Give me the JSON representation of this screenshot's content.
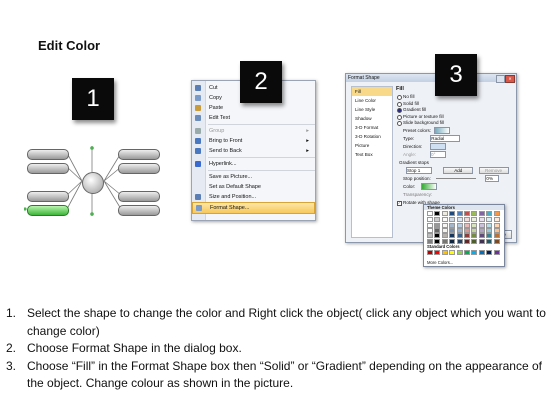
{
  "title": "Edit Color",
  "badges": [
    "1",
    "2",
    "3"
  ],
  "context_menu": {
    "items": [
      {
        "label": "Cut",
        "icon": "scissors-icon",
        "enabled": true,
        "submenu": false
      },
      {
        "label": "Copy",
        "icon": "copy-icon",
        "enabled": true,
        "submenu": false
      },
      {
        "label": "Paste",
        "icon": "paste-icon",
        "enabled": true,
        "submenu": false
      },
      {
        "label": "Edit Text",
        "icon": "edit-text-icon",
        "enabled": true,
        "submenu": false,
        "sep_after": true
      },
      {
        "label": "Group",
        "icon": "group-icon",
        "enabled": false,
        "submenu": true
      },
      {
        "label": "Bring to Front",
        "icon": "bring-front-icon",
        "enabled": true,
        "submenu": true
      },
      {
        "label": "Send to Back",
        "icon": "send-back-icon",
        "enabled": true,
        "submenu": true,
        "sep_after": true
      },
      {
        "label": "Hyperlink...",
        "icon": "hyperlink-icon",
        "enabled": true,
        "submenu": false,
        "sep_after": true
      },
      {
        "label": "Save as Picture...",
        "icon": "",
        "enabled": true,
        "submenu": false
      },
      {
        "label": "Set as Default Shape",
        "icon": "",
        "enabled": true,
        "submenu": false
      },
      {
        "label": "Size and Position...",
        "icon": "size-position-icon",
        "enabled": true,
        "submenu": false
      },
      {
        "label": "Format Shape...",
        "icon": "format-shape-icon",
        "enabled": true,
        "submenu": false,
        "highlighted": true
      }
    ]
  },
  "dialog": {
    "title": "Format Shape",
    "nav": [
      "Fill",
      "Line Color",
      "Line Style",
      "Shadow",
      "3-D Format",
      "3-D Rotation",
      "Picture",
      "Text Box"
    ],
    "selected_nav": "Fill",
    "fill_heading": "Fill",
    "fill_options": [
      {
        "label": "No fill",
        "selected": false
      },
      {
        "label": "Solid fill",
        "selected": false
      },
      {
        "label": "Gradient fill",
        "selected": true
      },
      {
        "label": "Picture or texture fill",
        "selected": false
      },
      {
        "label": "Slide background fill",
        "selected": false
      }
    ],
    "preset_colors_label": "Preset colors:",
    "type_label": "Type:",
    "type_value": "Radial",
    "direction_label": "Direction:",
    "angle_label": "Angle:",
    "angle_value": "0°",
    "gradient_stops_label": "Gradient stops",
    "stop_value": "Stop 1",
    "add_label": "Add",
    "remove_label": "Remove",
    "stop_position_label": "Stop position:",
    "stop_position_value": "0%",
    "color_label": "Color:",
    "transparency_label": "Transparency:",
    "rotate_label": "Rotate with shape",
    "close_label": "Close"
  },
  "palette": {
    "theme_label": "Theme Colors",
    "standard_label": "Standard Colors",
    "more_label": "More Colors...",
    "theme_top": [
      "#ffffff",
      "#000000",
      "#eeece1",
      "#1f497d",
      "#4f81bd",
      "#c0504d",
      "#9bbb59",
      "#8064a2",
      "#4bacc6",
      "#f79646"
    ],
    "standard": [
      "#c00000",
      "#ff0000",
      "#ffc000",
      "#ffff00",
      "#92d050",
      "#00b050",
      "#00b0f0",
      "#0070c0",
      "#002060",
      "#7030a0"
    ]
  },
  "instructions": [
    {
      "num": "1.",
      "text": "Select the shape to change the color and Right click the object( click any object which you want to change color)"
    },
    {
      "num": "2.",
      "text": "Choose Format Shape in the dialog box."
    },
    {
      "num": "3.",
      "text": "Choose “Fill” in the Format Shape box then “Solid” or “Gradient” depending on the appearance of the object. Change colour as shown in the picture."
    }
  ]
}
